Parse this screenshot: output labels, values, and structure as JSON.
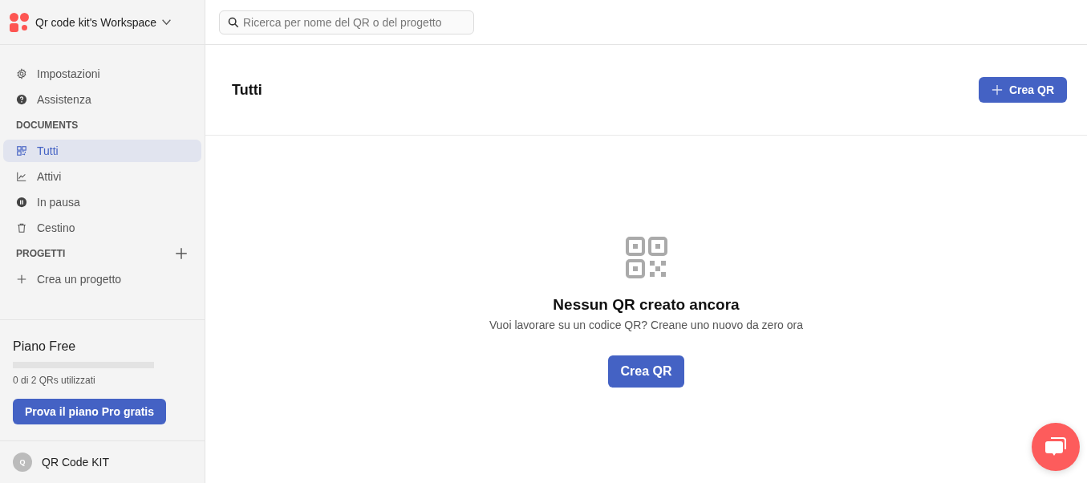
{
  "workspace": {
    "name": "Qr code kit's Workspace"
  },
  "search": {
    "placeholder": "Ricerca per nome del QR o del progetto"
  },
  "sidebar": {
    "items": [
      {
        "label": "Impostazioni",
        "kind": "gear",
        "selected": false
      },
      {
        "label": "Assistenza",
        "kind": "help",
        "selected": false
      }
    ],
    "documents": {
      "title": "DOCUMENTS",
      "items": [
        {
          "label": "Tutti",
          "kind": "qr",
          "selected": true
        },
        {
          "label": "Attivi",
          "kind": "chart",
          "selected": false
        },
        {
          "label": "In pausa",
          "kind": "pause",
          "selected": false
        },
        {
          "label": "Cestino",
          "kind": "trash",
          "selected": false
        }
      ]
    },
    "projects": {
      "title": "PROGETTI",
      "create": "Crea un progetto"
    }
  },
  "plan": {
    "title": "Piano Free",
    "level": 0,
    "usage": "0 di 2 QRs utilizzati",
    "button": "Prova il piano Pro gratis"
  },
  "user": {
    "initial": "Q",
    "name": "QR Code KIT"
  },
  "page": {
    "title": "Tutti",
    "create_button": "Crea QR"
  },
  "empty_state": {
    "title": "Nessun QR creato ancora",
    "text": "Vuoi lavorare su un codice QR? Creane uno nuovo da zero ora",
    "button": "Crea QR"
  }
}
